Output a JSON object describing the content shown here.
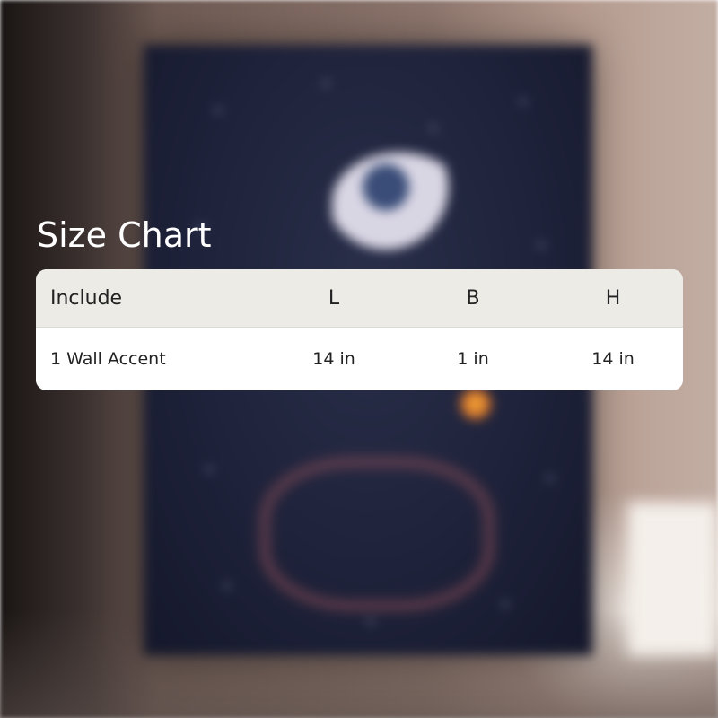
{
  "title": "Size Chart",
  "table": {
    "headers": [
      "Include",
      "L",
      "B",
      "H"
    ],
    "rows": [
      [
        "1 Wall Accent",
        "14 in",
        "1 in",
        "14 in"
      ]
    ]
  },
  "colors": {
    "header_bg": "#ecebe6",
    "row_bg": "#ffffff",
    "title_text": "#ffffff",
    "cell_text": "#222222"
  }
}
